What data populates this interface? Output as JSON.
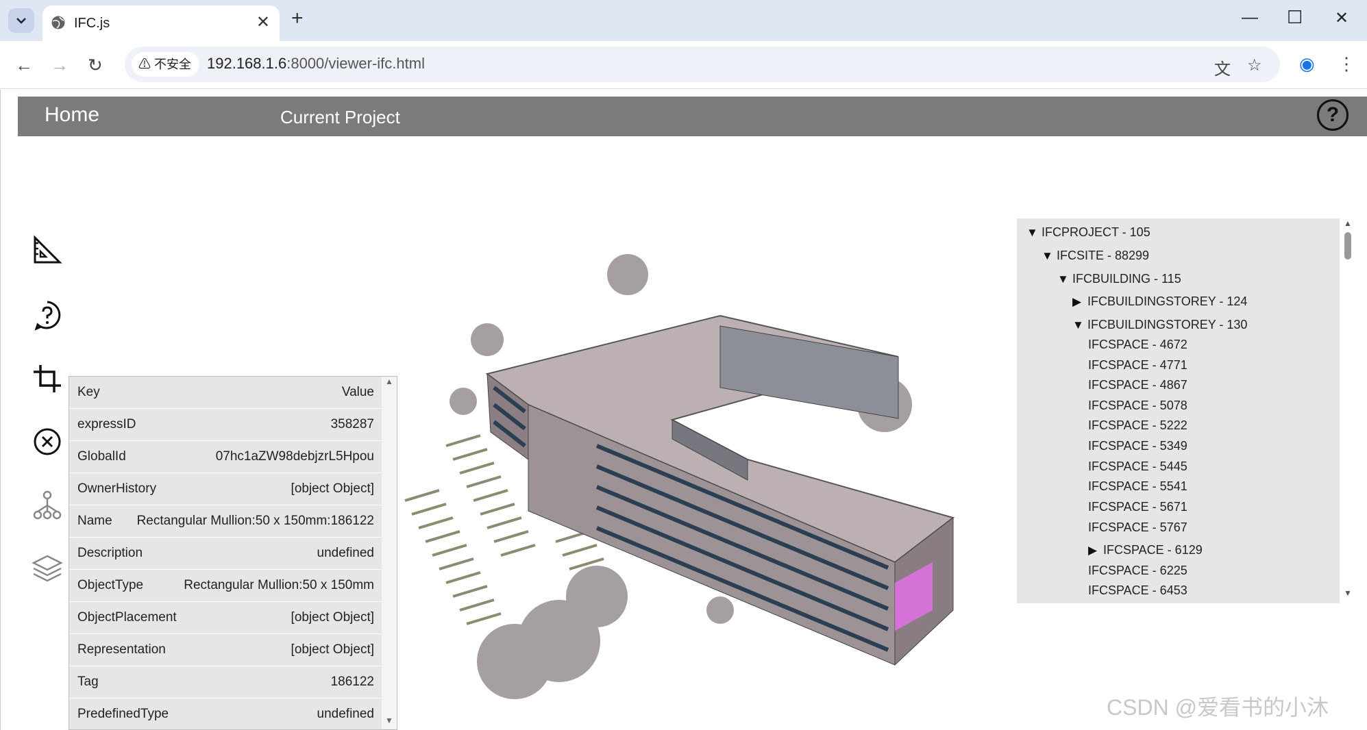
{
  "browser": {
    "tab_title": "IFC.js",
    "url_host": "192.168.1.6",
    "url_rest": ":8000/viewer-ifc.html",
    "security_label": "不安全"
  },
  "navbar": {
    "home": "Home",
    "current_project": "Current Project",
    "help": "?"
  },
  "properties": {
    "header": {
      "key": "Key",
      "value": "Value"
    },
    "rows": [
      {
        "key": "expressID",
        "value": "358287"
      },
      {
        "key": "GlobalId",
        "value": "07hc1aZW98debjzrL5Hpou"
      },
      {
        "key": "OwnerHistory",
        "value": "[object Object]"
      },
      {
        "key": "Name",
        "value": "Rectangular Mullion:50 x 150mm:186122"
      },
      {
        "key": "Description",
        "value": "undefined"
      },
      {
        "key": "ObjectType",
        "value": "Rectangular Mullion:50 x 150mm"
      },
      {
        "key": "ObjectPlacement",
        "value": "[object Object]"
      },
      {
        "key": "Representation",
        "value": "[object Object]"
      },
      {
        "key": "Tag",
        "value": "186122"
      },
      {
        "key": "PredefinedType",
        "value": "undefined"
      }
    ]
  },
  "tree": [
    {
      "label": "IFCPROJECT - 105",
      "state": "expanded"
    },
    {
      "label": "IFCSITE - 88299",
      "state": "expanded"
    },
    {
      "label": "IFCBUILDING - 115",
      "state": "expanded"
    },
    {
      "label": "IFCBUILDINGSTOREY - 124",
      "state": "collapsed"
    },
    {
      "label": "IFCBUILDINGSTOREY - 130",
      "state": "expanded"
    },
    {
      "label": "IFCSPACE - 4672",
      "state": "leaf"
    },
    {
      "label": "IFCSPACE - 4771",
      "state": "leaf"
    },
    {
      "label": "IFCSPACE - 4867",
      "state": "leaf"
    },
    {
      "label": "IFCSPACE - 5078",
      "state": "leaf"
    },
    {
      "label": "IFCSPACE - 5222",
      "state": "leaf"
    },
    {
      "label": "IFCSPACE - 5349",
      "state": "leaf"
    },
    {
      "label": "IFCSPACE - 5445",
      "state": "leaf"
    },
    {
      "label": "IFCSPACE - 5541",
      "state": "leaf"
    },
    {
      "label": "IFCSPACE - 5671",
      "state": "leaf"
    },
    {
      "label": "IFCSPACE - 5767",
      "state": "leaf"
    },
    {
      "label": "IFCSPACE - 6129",
      "state": "collapsed"
    },
    {
      "label": "IFCSPACE - 6225",
      "state": "leaf"
    },
    {
      "label": "IFCSPACE - 6453",
      "state": "leaf"
    }
  ],
  "watermark": "CSDN @爱看书的小沐",
  "colors": {
    "navbar": "#7b7b7b",
    "highlight": "#e070e6",
    "panel": "#e6e6e6"
  }
}
